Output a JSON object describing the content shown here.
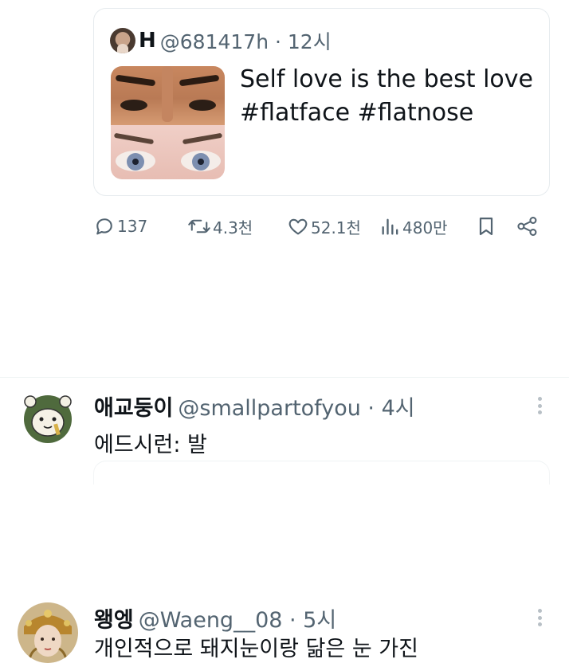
{
  "quote": {
    "name": "H",
    "handle_time": "@681417h · 12시",
    "text": "Self love is the best love\n#flatface #flatnose"
  },
  "actions": {
    "replies": "137",
    "retweets": "4.3천",
    "likes": "52.1천",
    "views": "480만"
  },
  "replies": [
    {
      "name": "애교둥이",
      "handle_time": "@smallpartofyou · 4시",
      "text": "에드시런:       발"
    },
    {
      "name": "왱엥",
      "handle_time": "@Waeng__08 · 5시",
      "text": "개인적으로 돼지눈이랑 닮은 눈 가진"
    }
  ],
  "colors": {
    "text": "#0f1419",
    "secondary": "#536471",
    "border": "#e6ebee"
  }
}
